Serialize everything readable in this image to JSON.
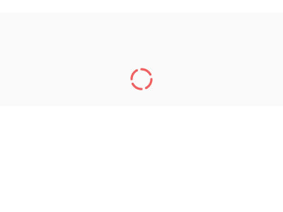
{
  "loading": {
    "icon": "loading-spinner-icon",
    "spinner_color": "#f06060"
  },
  "colors": {
    "page_background": "#ffffff",
    "hero_background": "#f4f4f4"
  }
}
